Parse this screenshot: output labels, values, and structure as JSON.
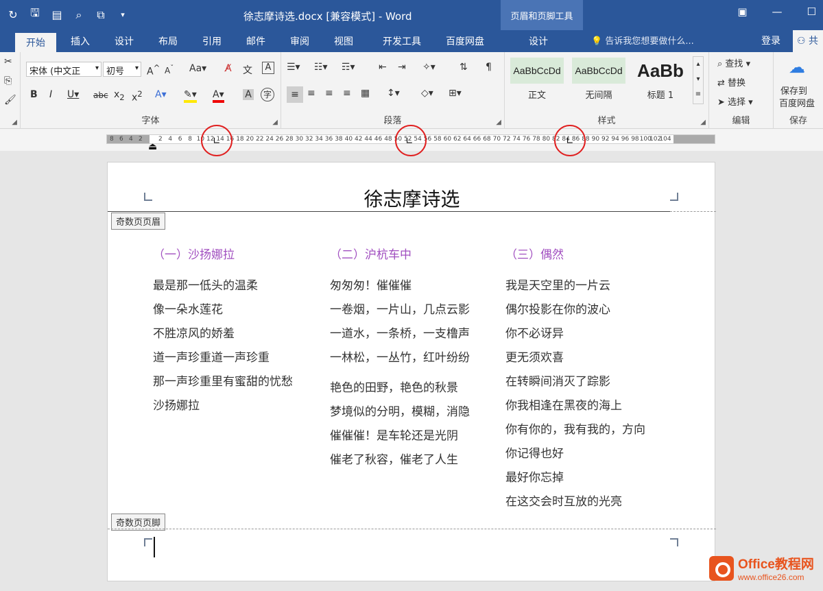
{
  "titlebar": {
    "doc_title": "徐志摩诗选.docx [兼容模式] - Word",
    "context_tab_group": "页眉和页脚工具",
    "qat_icons": [
      "refresh-icon",
      "save-icon",
      "format-icon",
      "find-icon",
      "screenshot-icon",
      "more-icon"
    ],
    "window_icons": [
      "ribbon-options-icon",
      "minimize-icon",
      "restore-icon"
    ]
  },
  "tabs": [
    "开始",
    "插入",
    "设计",
    "布局",
    "引用",
    "邮件",
    "审阅",
    "视图",
    "开发工具",
    "百度网盘",
    "设计"
  ],
  "tell_me": "告诉我您想要做什么...",
  "login": "登录",
  "share": "共",
  "ribbon": {
    "font_group": "字体",
    "font_name": "宋体 (中文正",
    "font_size": "初号",
    "paragraph_group": "段落",
    "styles_group": "样式",
    "styles": [
      {
        "preview": "AaBbCcDd",
        "label": "正文"
      },
      {
        "preview": "AaBbCcDd",
        "label": "无间隔"
      },
      {
        "preview": "AaBb",
        "label": "标题 1"
      }
    ],
    "edit_group": "编辑",
    "find": "查找",
    "replace": "替换",
    "select": "选择",
    "save_group": "保存",
    "save_to_baidu": "保存到",
    "baidu_netdisk": "百度网盘"
  },
  "ruler": {
    "left_numbers": [
      "8",
      "6",
      "4",
      "2"
    ],
    "numbers": [
      "2",
      "4",
      "6",
      "8",
      "10",
      "12",
      "14",
      "16",
      "18",
      "20",
      "22",
      "24",
      "26",
      "28",
      "30",
      "32",
      "34",
      "36",
      "38",
      "40",
      "42",
      "44",
      "46",
      "48",
      "50",
      "52",
      "54",
      "56",
      "58",
      "60",
      "62",
      "64",
      "66",
      "68",
      "70",
      "72",
      "74",
      "76",
      "78",
      "80",
      "82",
      "84",
      "86",
      "88",
      "90",
      "92",
      "94",
      "96",
      "98",
      "100",
      "102",
      "104"
    ]
  },
  "document": {
    "title": "徐志摩诗选",
    "header_label": "奇数页页眉",
    "footer_label": "奇数页页脚",
    "columns": [
      {
        "heading": "（一）沙扬娜拉",
        "stanzas": [
          [
            "最是那一低头的温柔",
            "像一朵水莲花",
            "不胜凉风的娇羞",
            "道一声珍重道一声珍重",
            "那一声珍重里有蜜甜的忧愁",
            "沙扬娜拉"
          ]
        ]
      },
      {
        "heading": "（二）沪杭车中",
        "stanzas": [
          [
            "匆匆匆！催催催",
            "一卷烟，一片山，几点云影",
            "一道水，一条桥，一支橹声",
            "一林松，一丛竹，红叶纷纷"
          ],
          [
            "艳色的田野，艳色的秋景",
            "梦境似的分明，模糊，消隐",
            "催催催！是车轮还是光阴",
            "催老了秋容，催老了人生"
          ]
        ]
      },
      {
        "heading": "（三）偶然",
        "stanzas": [
          [
            "我是天空里的一片云",
            "偶尔投影在你的波心",
            "你不必讶异",
            "更无须欢喜",
            "在转瞬间消灭了踪影",
            "你我相逢在黑夜的海上",
            "你有你的，我有我的，方向",
            "你记得也好",
            "最好你忘掉",
            "在这交会时互放的光亮"
          ]
        ]
      }
    ]
  },
  "watermark": {
    "main": "Office教程网",
    "sub": "www.office26.com"
  }
}
